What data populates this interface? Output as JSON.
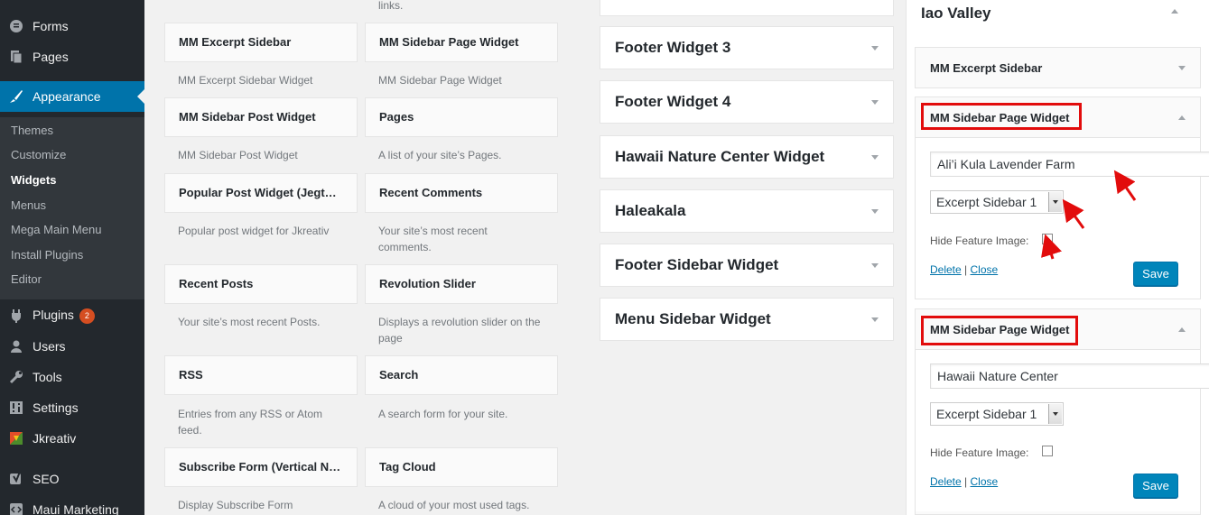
{
  "admin_menu": {
    "items": [
      {
        "label": "Forms",
        "icon": "forms-icon"
      },
      {
        "label": "Pages",
        "icon": "pages-icon"
      },
      {
        "label": "Appearance",
        "icon": "appearance-icon"
      },
      {
        "label": "Plugins",
        "icon": "plugins-icon",
        "badge": "2"
      },
      {
        "label": "Users",
        "icon": "users-icon"
      },
      {
        "label": "Tools",
        "icon": "tools-icon"
      },
      {
        "label": "Settings",
        "icon": "settings-icon"
      },
      {
        "label": "Jkreativ",
        "icon": "jkreativ-icon"
      },
      {
        "label": "SEO",
        "icon": "seo-icon"
      },
      {
        "label": "Maui Marketing",
        "icon": "code-icon"
      }
    ],
    "submenu": [
      "Themes",
      "Customize",
      "Widgets",
      "Menus",
      "Mega Main Menu",
      "Install Plugins",
      "Editor"
    ],
    "active_sub": "Widgets"
  },
  "available_widgets": {
    "top_desc": "links.",
    "widgets": [
      {
        "name": "MM Excerpt Sidebar",
        "desc": "MM Excerpt Sidebar Widget"
      },
      {
        "name": "MM Sidebar Page Widget",
        "desc": "MM Sidebar Page Widget"
      },
      {
        "name": "MM Sidebar Post Widget",
        "desc": "MM Sidebar Post Widget"
      },
      {
        "name": "Pages",
        "desc": "A list of your site’s Pages."
      },
      {
        "name": "Popular Post Widget (Jegtheme)",
        "desc": "Popular post widget for Jkreativ"
      },
      {
        "name": "Recent Comments",
        "desc": "Your site’s most recent comments."
      },
      {
        "name": "Recent Posts",
        "desc": "Your site’s most recent Posts."
      },
      {
        "name": "Revolution Slider",
        "desc": "Displays a revolution slider on the page"
      },
      {
        "name": "RSS",
        "desc": "Entries from any RSS or Atom feed."
      },
      {
        "name": "Search",
        "desc": "A search form for your site."
      },
      {
        "name": "Subscribe Form (Vertical Newsletter)",
        "desc": "Display Subscribe Form"
      },
      {
        "name": "Tag Cloud",
        "desc": "A cloud of your most used tags."
      }
    ]
  },
  "sidebars": [
    "Footer Widget 3",
    "Footer Widget 4",
    "Hawaii Nature Center Widget",
    "Haleakala",
    "Footer Sidebar Widget",
    "Menu Sidebar Widget"
  ],
  "right_panel": {
    "title": "Iao Valley",
    "excerpt_widget": "MM Excerpt Sidebar",
    "page_widgets": [
      {
        "title": "MM Sidebar Page Widget",
        "text_value": "Ali’i Kula Lavender Farm",
        "select_value": "Excerpt Sidebar 1",
        "hide_label": "Hide Feature Image:",
        "delete": "Delete",
        "sep": "|",
        "close": "Close",
        "save": "Save"
      },
      {
        "title": "MM Sidebar Page Widget",
        "text_value": "Hawaii Nature Center",
        "select_value": "Excerpt Sidebar 1",
        "hide_label": "Hide Feature Image:",
        "delete": "Delete",
        "sep": "|",
        "close": "Close",
        "save": "Save"
      }
    ]
  },
  "colors": {
    "menu_bg": "#23282d",
    "submenu_bg": "#32373c",
    "active": "#0073aa",
    "annotation": "#e20c0c"
  }
}
